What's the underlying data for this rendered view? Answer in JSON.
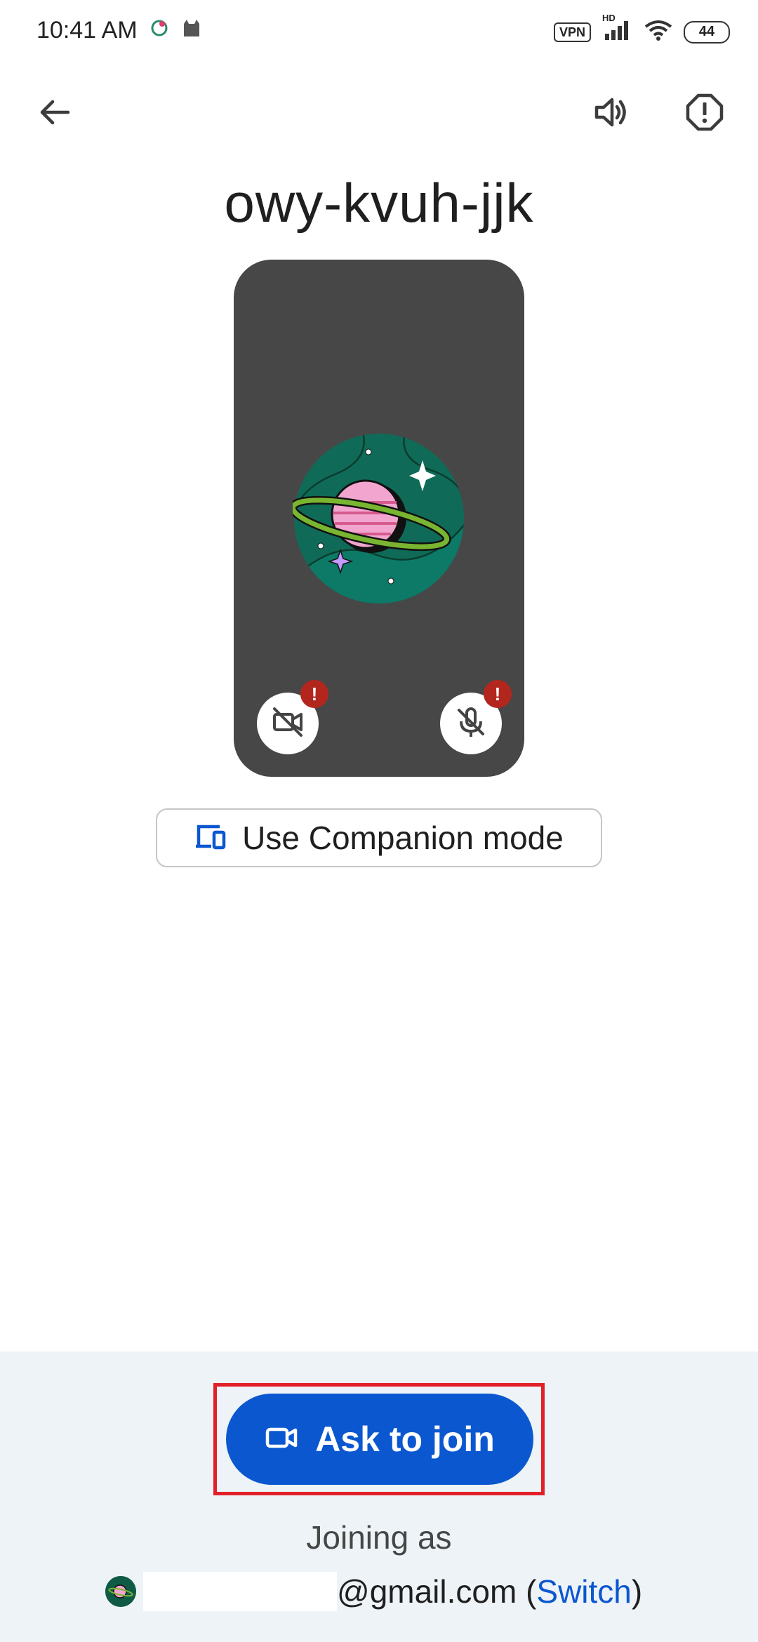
{
  "status_bar": {
    "time": "10:41 AM",
    "vpn": "VPN",
    "network": "HD",
    "battery": "44"
  },
  "top_bar": {
    "back_icon": "arrow-back-icon",
    "speaker_icon": "speaker-icon",
    "report_icon": "report-issue-icon"
  },
  "meeting": {
    "code": "owy-kvuh-jjk"
  },
  "preview": {
    "avatar_icon": "planet-avatar-icon",
    "camera_icon": "camera-off-icon",
    "mic_icon": "mic-off-icon",
    "alert_mark": "!"
  },
  "companion": {
    "label": "Use Companion mode",
    "icon": "devices-icon"
  },
  "join": {
    "label": "Ask to join",
    "icon": "video-camera-icon"
  },
  "account": {
    "joining_as": "Joining as",
    "email_suffix": "@gmail.com (",
    "switch_label": "Switch",
    "close_paren": ")"
  },
  "colors": {
    "primary": "#0b57d0",
    "preview_bg": "#474747",
    "alert": "#b3261e",
    "highlight": "#e1202a",
    "panel_bg": "#eef3f7"
  }
}
